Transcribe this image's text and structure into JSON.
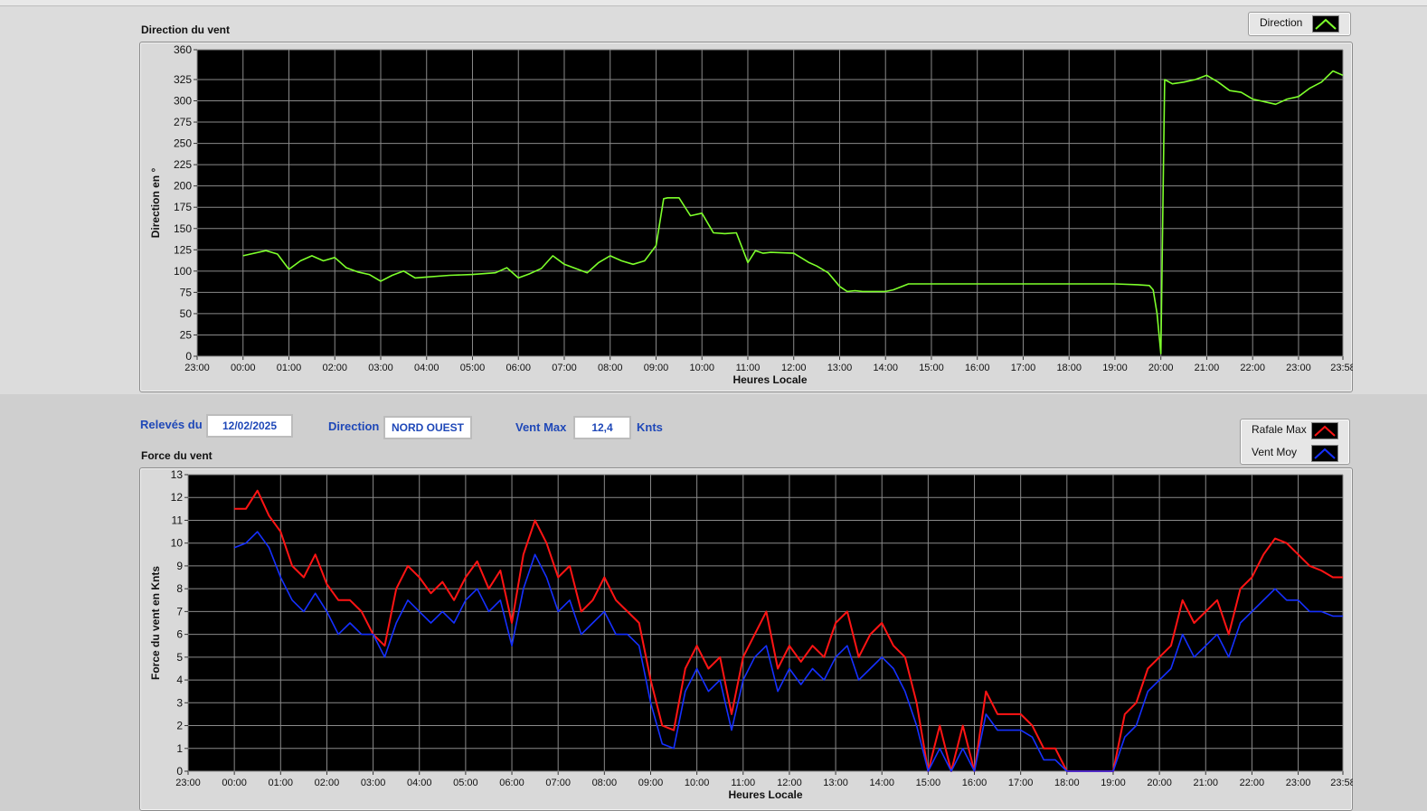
{
  "direction_panel": {
    "title": "Direction du vent",
    "legend": {
      "label": "Direction",
      "color": "#7dff2b"
    }
  },
  "info": {
    "releves_label": "Relevés du",
    "date": "12/02/2025",
    "direction_label": "Direction",
    "direction_value": "NORD OUEST",
    "vent_max_label": "Vent Max",
    "vent_max_value": "12,4",
    "unit": "Knts"
  },
  "force_panel": {
    "title": "Force du vent",
    "legend": [
      {
        "label": "Rafale Max",
        "color": "#ff1414"
      },
      {
        "label": "Vent Moy",
        "color": "#1530ff"
      }
    ]
  },
  "chart_data": [
    {
      "type": "line",
      "title": "",
      "xlabel": "Heures Locale",
      "ylabel": "Direction en °",
      "ylim": [
        0,
        360
      ],
      "yticks": [
        0,
        25,
        50,
        75,
        100,
        125,
        150,
        175,
        200,
        225,
        250,
        275,
        300,
        325,
        360
      ],
      "xticks": [
        "23:00",
        "00:00",
        "01:00",
        "02:00",
        "03:00",
        "04:00",
        "05:00",
        "06:00",
        "07:00",
        "08:00",
        "09:00",
        "10:00",
        "11:00",
        "12:00",
        "13:00",
        "14:00",
        "15:00",
        "16:00",
        "17:00",
        "18:00",
        "19:00",
        "20:00",
        "21:00",
        "22:00",
        "23:00",
        "23:58"
      ],
      "grid": true,
      "series": [
        {
          "name": "Direction",
          "color": "#7dff2b",
          "x": [
            "00:00",
            "00:30",
            "00:45",
            "01:00",
            "01:15",
            "01:30",
            "01:45",
            "02:00",
            "02:15",
            "02:30",
            "02:45",
            "03:00",
            "03:15",
            "03:30",
            "03:45",
            "04:00",
            "04:30",
            "05:00",
            "05:30",
            "05:45",
            "06:00",
            "06:15",
            "06:30",
            "06:45",
            "07:00",
            "07:15",
            "07:30",
            "07:45",
            "08:00",
            "08:15",
            "08:30",
            "08:45",
            "09:00",
            "09:10",
            "09:15",
            "09:30",
            "09:45",
            "10:00",
            "10:15",
            "10:30",
            "10:45",
            "11:00",
            "11:10",
            "11:20",
            "11:30",
            "12:00",
            "12:20",
            "12:30",
            "12:45",
            "13:00",
            "13:10",
            "13:20",
            "13:30",
            "14:00",
            "14:10",
            "14:30",
            "15:00",
            "16:00",
            "17:00",
            "18:00",
            "19:00",
            "19:30",
            "19:45",
            "19:50",
            "19:55",
            "20:00",
            "20:05",
            "20:15",
            "20:30",
            "20:45",
            "21:00",
            "21:15",
            "21:30",
            "21:45",
            "22:00",
            "22:30",
            "22:45",
            "23:00",
            "23:15",
            "23:30",
            "23:45",
            "23:58"
          ],
          "values": [
            118,
            124,
            120,
            102,
            112,
            118,
            112,
            116,
            104,
            99,
            96,
            88,
            95,
            100,
            92,
            93,
            95,
            96,
            98,
            104,
            92,
            97,
            103,
            118,
            108,
            103,
            98,
            110,
            118,
            112,
            108,
            112,
            130,
            185,
            186,
            186,
            165,
            168,
            145,
            144,
            145,
            110,
            124,
            121,
            122,
            121,
            110,
            106,
            98,
            82,
            76,
            77,
            76,
            76,
            78,
            85,
            85,
            85,
            85,
            85,
            85,
            84,
            83,
            78,
            50,
            3,
            325,
            320,
            322,
            325,
            330,
            322,
            312,
            310,
            302,
            296,
            302,
            305,
            315,
            322,
            335,
            330
          ]
        }
      ]
    },
    {
      "type": "line",
      "title": "",
      "xlabel": "Heures Locale",
      "ylabel": "Force du vent en Knts",
      "ylim": [
        0,
        13
      ],
      "yticks": [
        0,
        1,
        2,
        3,
        4,
        5,
        6,
        7,
        8,
        9,
        10,
        11,
        12,
        13
      ],
      "xticks": [
        "23:00",
        "00:00",
        "01:00",
        "02:00",
        "03:00",
        "04:00",
        "05:00",
        "06:00",
        "07:00",
        "08:00",
        "09:00",
        "10:00",
        "11:00",
        "12:00",
        "13:00",
        "14:00",
        "15:00",
        "16:00",
        "17:00",
        "18:00",
        "19:00",
        "20:00",
        "21:00",
        "22:00",
        "23:00",
        "23:58"
      ],
      "grid": true,
      "series": [
        {
          "name": "Rafale Max",
          "color": "#ff1414",
          "x": [
            "00:00",
            "00:15",
            "00:30",
            "00:45",
            "01:00",
            "01:15",
            "01:30",
            "01:45",
            "02:00",
            "02:15",
            "02:30",
            "02:45",
            "03:00",
            "03:15",
            "03:30",
            "03:45",
            "04:00",
            "04:15",
            "04:30",
            "04:45",
            "05:00",
            "05:15",
            "05:30",
            "05:45",
            "06:00",
            "06:15",
            "06:30",
            "06:45",
            "07:00",
            "07:15",
            "07:30",
            "07:45",
            "08:00",
            "08:15",
            "08:30",
            "08:45",
            "09:00",
            "09:15",
            "09:30",
            "09:45",
            "10:00",
            "10:15",
            "10:30",
            "10:45",
            "11:00",
            "11:15",
            "11:30",
            "11:45",
            "12:00",
            "12:15",
            "12:30",
            "12:45",
            "13:00",
            "13:15",
            "13:30",
            "13:45",
            "14:00",
            "14:15",
            "14:30",
            "14:45",
            "15:00",
            "15:15",
            "15:30",
            "15:45",
            "16:00",
            "16:15",
            "16:30",
            "16:45",
            "17:00",
            "17:15",
            "17:30",
            "17:45",
            "18:00",
            "18:15",
            "18:30",
            "18:45",
            "19:00",
            "19:15",
            "19:30",
            "19:45",
            "20:00",
            "20:15",
            "20:30",
            "20:45",
            "21:00",
            "21:15",
            "21:30",
            "21:45",
            "22:00",
            "22:15",
            "22:30",
            "22:45",
            "23:00",
            "23:15",
            "23:30",
            "23:45",
            "23:58"
          ],
          "values": [
            11.5,
            11.5,
            12.3,
            11.2,
            10.5,
            9.0,
            8.5,
            9.5,
            8.2,
            7.5,
            7.5,
            7.0,
            6.0,
            5.5,
            8.0,
            9.0,
            8.5,
            7.8,
            8.3,
            7.5,
            8.5,
            9.2,
            8.0,
            8.8,
            6.5,
            9.5,
            11.0,
            10.0,
            8.5,
            9.0,
            7.0,
            7.5,
            8.5,
            7.5,
            7.0,
            6.5,
            4.0,
            2.0,
            1.8,
            4.5,
            5.5,
            4.5,
            5.0,
            2.5,
            5.0,
            6.0,
            7.0,
            4.5,
            5.5,
            4.8,
            5.5,
            5.0,
            6.5,
            7.0,
            5.0,
            6.0,
            6.5,
            5.5,
            5.0,
            3.0,
            0.0,
            2.0,
            0.0,
            2.0,
            0.0,
            3.5,
            2.5,
            2.5,
            2.5,
            2.0,
            1.0,
            1.0,
            0.0,
            0.0,
            0.0,
            0.0,
            0.0,
            2.5,
            3.0,
            4.5,
            5.0,
            5.5,
            7.5,
            6.5,
            7.0,
            7.5,
            6.0,
            8.0,
            8.5,
            9.5,
            10.2,
            10.0,
            9.5,
            9.0,
            8.8,
            8.5,
            8.5
          ]
        },
        {
          "name": "Vent Moy",
          "color": "#1530ff",
          "x": [
            "00:00",
            "00:15",
            "00:30",
            "00:45",
            "01:00",
            "01:15",
            "01:30",
            "01:45",
            "02:00",
            "02:15",
            "02:30",
            "02:45",
            "03:00",
            "03:15",
            "03:30",
            "03:45",
            "04:00",
            "04:15",
            "04:30",
            "04:45",
            "05:00",
            "05:15",
            "05:30",
            "05:45",
            "06:00",
            "06:15",
            "06:30",
            "06:45",
            "07:00",
            "07:15",
            "07:30",
            "07:45",
            "08:00",
            "08:15",
            "08:30",
            "08:45",
            "09:00",
            "09:15",
            "09:30",
            "09:45",
            "10:00",
            "10:15",
            "10:30",
            "10:45",
            "11:00",
            "11:15",
            "11:30",
            "11:45",
            "12:00",
            "12:15",
            "12:30",
            "12:45",
            "13:00",
            "13:15",
            "13:30",
            "13:45",
            "14:00",
            "14:15",
            "14:30",
            "14:45",
            "15:00",
            "15:15",
            "15:30",
            "15:45",
            "16:00",
            "16:15",
            "16:30",
            "16:45",
            "17:00",
            "17:15",
            "17:30",
            "17:45",
            "18:00",
            "18:15",
            "18:30",
            "18:45",
            "19:00",
            "19:15",
            "19:30",
            "19:45",
            "20:00",
            "20:15",
            "20:30",
            "20:45",
            "21:00",
            "21:15",
            "21:30",
            "21:45",
            "22:00",
            "22:15",
            "22:30",
            "22:45",
            "23:00",
            "23:15",
            "23:30",
            "23:45",
            "23:58"
          ],
          "values": [
            9.8,
            10.0,
            10.5,
            9.8,
            8.5,
            7.5,
            7.0,
            7.8,
            7.0,
            6.0,
            6.5,
            6.0,
            6.0,
            5.0,
            6.5,
            7.5,
            7.0,
            6.5,
            7.0,
            6.5,
            7.5,
            8.0,
            7.0,
            7.5,
            5.5,
            8.0,
            9.5,
            8.5,
            7.0,
            7.5,
            6.0,
            6.5,
            7.0,
            6.0,
            6.0,
            5.5,
            3.0,
            1.2,
            1.0,
            3.5,
            4.5,
            3.5,
            4.0,
            1.8,
            4.0,
            5.0,
            5.5,
            3.5,
            4.5,
            3.8,
            4.5,
            4.0,
            5.0,
            5.5,
            4.0,
            4.5,
            5.0,
            4.5,
            3.5,
            2.0,
            0.0,
            1.0,
            0.0,
            1.0,
            0.0,
            2.5,
            1.8,
            1.8,
            1.8,
            1.5,
            0.5,
            0.5,
            0.0,
            0.0,
            0.0,
            0.0,
            0.0,
            1.5,
            2.0,
            3.5,
            4.0,
            4.5,
            6.0,
            5.0,
            5.5,
            6.0,
            5.0,
            6.5,
            7.0,
            7.5,
            8.0,
            7.5,
            7.5,
            7.0,
            7.0,
            6.8,
            6.8
          ]
        }
      ]
    }
  ]
}
